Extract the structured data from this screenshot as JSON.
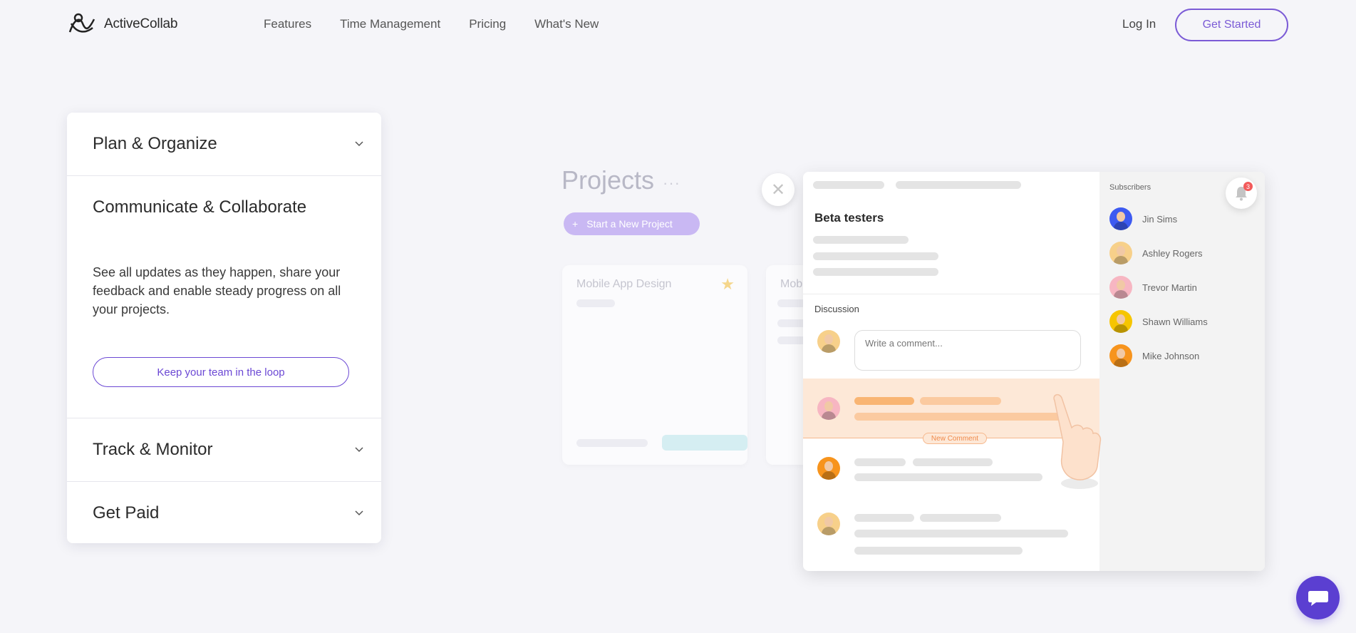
{
  "brand": {
    "name": "ActiveCollab",
    "accent": "#7b5bd6"
  },
  "nav": {
    "items": [
      "Features",
      "Time Management",
      "Pricing",
      "What's New"
    ]
  },
  "auth": {
    "login": "Log In",
    "cta": "Get Started"
  },
  "accordion": {
    "items": [
      {
        "title": "Plan & Organize",
        "open": false
      },
      {
        "title": "Communicate & Collaborate",
        "open": true,
        "description": "See all updates as they happen, share your feedback and enable steady progress on all your projects.",
        "button": "Keep your team in the loop"
      },
      {
        "title": "Track & Monitor",
        "open": false
      },
      {
        "title": "Get Paid",
        "open": false
      }
    ]
  },
  "illustration": {
    "projects_title": "Projects",
    "projects_menu": "···",
    "new_project": "Start a New Project",
    "cards": [
      "Mobile App Design",
      "Mob"
    ],
    "task": {
      "title": "Beta testers",
      "discussion_label": "Discussion",
      "comment_placeholder": "Write a comment...",
      "new_comment_badge": "New Comment"
    },
    "subscribers": {
      "title": "Subscribers",
      "people": [
        {
          "name": "Jin Sims",
          "color": "#3d5af1"
        },
        {
          "name": "Ashley Rogers",
          "color": "#f7d08a"
        },
        {
          "name": "Trevor Martin",
          "color": "#f7b6c2"
        },
        {
          "name": "Shawn Williams",
          "color": "#f6c500"
        },
        {
          "name": "Mike Johnson",
          "color": "#f7941d"
        }
      ]
    },
    "notifications": {
      "count": "3"
    }
  }
}
